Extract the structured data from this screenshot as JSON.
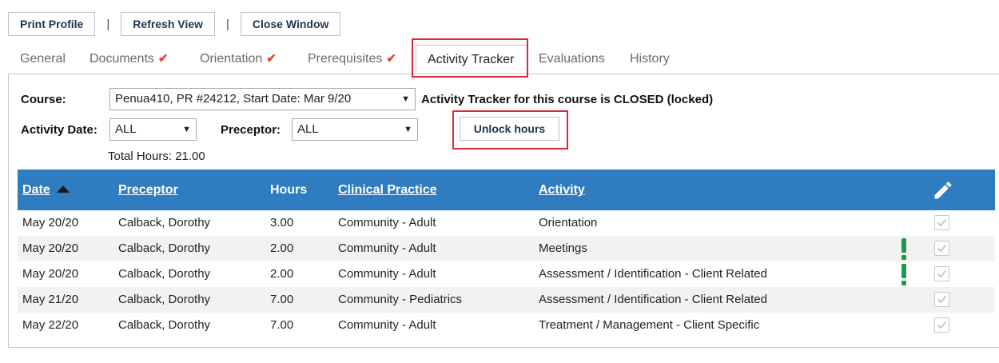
{
  "toolbar": {
    "print_label": "Print Profile",
    "refresh_label": "Refresh View",
    "close_label": "Close Window",
    "separator": "|"
  },
  "tabs": {
    "general": "General",
    "documents": "Documents",
    "orientation": "Orientation",
    "prerequisites": "Prerequisites",
    "activity_tracker": "Activity Tracker",
    "evaluations": "Evaluations",
    "history": "History",
    "check_glyph": "✔"
  },
  "filters": {
    "course_label": "Course:",
    "course_value": "Penua410, PR #24212, Start Date: Mar 9/20",
    "status_text": "Activity Tracker for this course is CLOSED (locked)",
    "activity_date_label": "Activity Date:",
    "activity_date_value": "ALL",
    "preceptor_label": "Preceptor:",
    "preceptor_value": "ALL",
    "unlock_label": "Unlock hours",
    "total_hours": "Total Hours: 21.00"
  },
  "table": {
    "headers": {
      "date": "Date",
      "preceptor": "Preceptor",
      "hours": "Hours",
      "clinical_practice": "Clinical Practice",
      "activity": "Activity"
    },
    "rows": [
      {
        "date": "May 20/20",
        "preceptor": "Calback, Dorothy",
        "hours": "3.00",
        "clinical_practice": "Community - Adult",
        "activity": "Orientation",
        "flagged": false,
        "checked": true
      },
      {
        "date": "May 20/20",
        "preceptor": "Calback, Dorothy",
        "hours": "2.00",
        "clinical_practice": "Community - Adult",
        "activity": "Meetings",
        "flagged": true,
        "checked": true
      },
      {
        "date": "May 20/20",
        "preceptor": "Calback, Dorothy",
        "hours": "2.00",
        "clinical_practice": "Community - Adult",
        "activity": "Assessment / Identification - Client Related",
        "flagged": true,
        "checked": true
      },
      {
        "date": "May 21/20",
        "preceptor": "Calback, Dorothy",
        "hours": "7.00",
        "clinical_practice": "Community - Pediatrics",
        "activity": "Assessment / Identification - Client Related",
        "flagged": false,
        "checked": true
      },
      {
        "date": "May 22/20",
        "preceptor": "Calback, Dorothy",
        "hours": "7.00",
        "clinical_practice": "Community - Adult",
        "activity": "Treatment / Management - Client Specific",
        "flagged": false,
        "checked": true
      }
    ]
  },
  "icons": {
    "sort": "sort-ascending-icon",
    "edit": "pencil-icon",
    "flag": "exclamation-icon",
    "checkbox": "checkbox-checked-icon"
  },
  "colors": {
    "header_bg": "#2f7cc0",
    "tab_check": "#e2462d",
    "highlight_box": "#d42b3a",
    "flag": "#1e9a4a",
    "button_text": "#1b3550",
    "row_alt": "#f2f2f2"
  }
}
